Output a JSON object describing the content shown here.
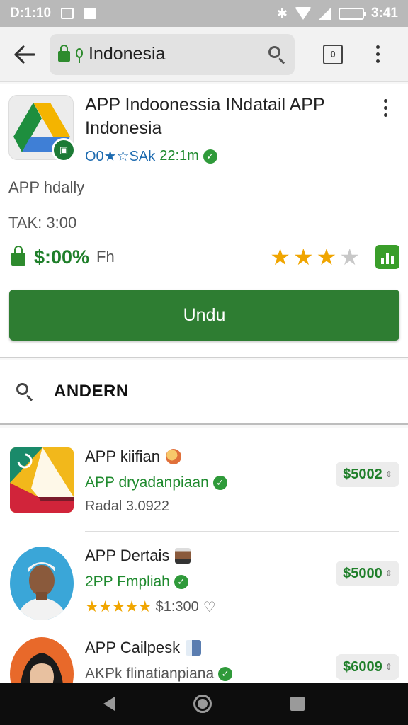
{
  "status_bar": {
    "time_left": "D:1:10",
    "time_right": "3:41",
    "bluetooth_glyph": "✱"
  },
  "toolbar": {
    "url_text": "Indonesia",
    "tabs_count": "0"
  },
  "app": {
    "title": "APP Indoonessia INdatail APP Indonesia",
    "developer_stats": "O0★☆SAk",
    "downloads": "22:1m",
    "subtitle": "APP hdally",
    "tak_line": "TAK: 3:00",
    "price": "$:00%",
    "price_unit": "Fh",
    "rating": 3,
    "rating_max": 4,
    "download_label": "Undu"
  },
  "search": {
    "label": "ANDERN"
  },
  "list": {
    "items": [
      {
        "title": "APP kiifian",
        "subtitle": "APP dryadanpiaan",
        "meta": "Radal 3.0922",
        "price": "$5002"
      },
      {
        "title": "APP Dertais",
        "subtitle": "2PP Fmpliah",
        "meta": "$1:300",
        "price": "$5000",
        "rating": 5
      },
      {
        "title": "APP Cailpesk",
        "subtitle": "AKPk flinatianpiana",
        "price": "$6009"
      }
    ]
  },
  "colors": {
    "accent_green": "#2e7d32",
    "price_green": "#1f7f2a",
    "star": "#f0a500",
    "dev_blue": "#1d6bb0"
  }
}
